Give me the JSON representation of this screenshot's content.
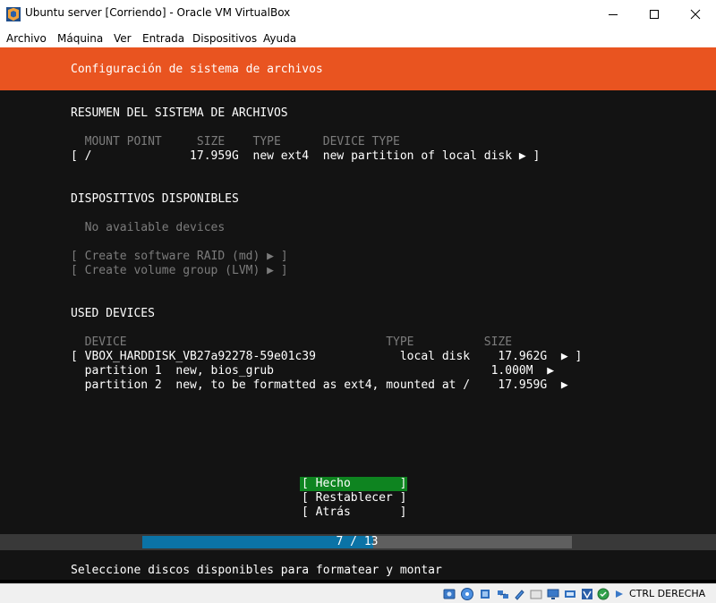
{
  "window": {
    "title": "Ubuntu server [Corriendo] - Oracle VM VirtualBox"
  },
  "menu": [
    "Archivo",
    "Máquina",
    "Ver",
    "Entrada",
    "Dispositivos",
    "Ayuda"
  ],
  "installer": {
    "header": "Configuración de sistema de archivos",
    "summary": {
      "title": "RESUMEN DEL SISTEMA DE ARCHIVOS",
      "columns": "  MOUNT POINT     SIZE    TYPE      DEVICE TYPE",
      "row": "[ /              17.959G  new ext4  new partition of local disk ▶ ]"
    },
    "available": {
      "title": "DISPOSITIVOS DISPONIBLES",
      "empty": "  No available devices",
      "create_raid": "[ Create software RAID (md) ▶ ]",
      "create_lvm": "[ Create volume group (LVM) ▶ ]"
    },
    "used": {
      "title": "USED DEVICES",
      "columns": "  DEVICE                                     TYPE          SIZE",
      "rows": [
        "[ VBOX_HARDDISK_VB27a92278-59e01c39            local disk    17.962G  ▶ ]",
        "  partition 1  new, bios_grub                               1.000M  ▶",
        "  partition 2  new, to be formatted as ext4, mounted at /    17.959G  ▶"
      ]
    },
    "buttons": {
      "done": "[ Hecho       ]",
      "reset": "[ Restablecer ]",
      "back": "[ Atrás       ]"
    },
    "progress": {
      "label": "7 / 13",
      "current": 7,
      "total": 13
    },
    "footer": "Seleccione discos disponibles para formatear y montar"
  },
  "statusbar": {
    "host_key": "CTRL DERECHA"
  },
  "colors": {
    "accent": "#e95420",
    "button_focus": "#0e8420",
    "progress_fill": "#0b73a6"
  }
}
